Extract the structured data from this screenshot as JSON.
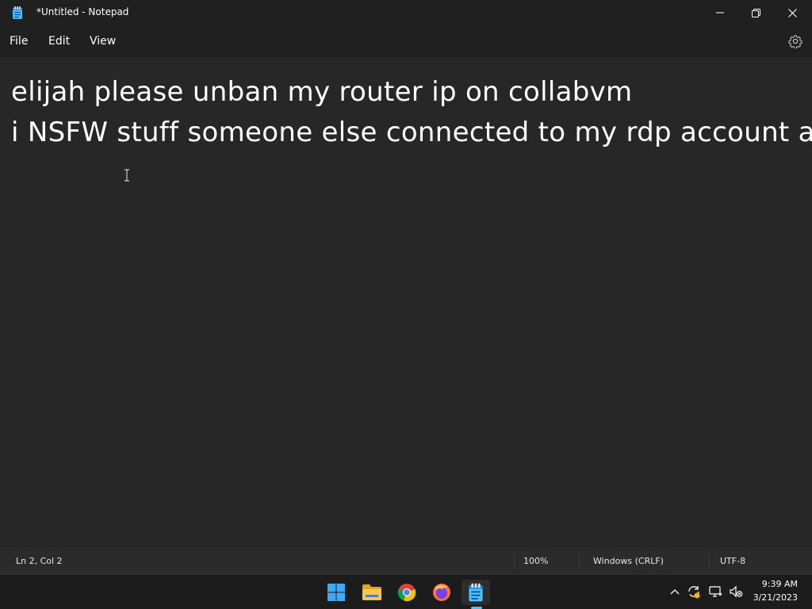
{
  "window": {
    "title": "*Untitled - Notepad",
    "icon": "notepad-icon"
  },
  "menu": {
    "file": "File",
    "edit": "Edit",
    "view": "View",
    "settings_icon": "gear-icon"
  },
  "editor": {
    "lines": [
      "elijah please unban my router ip on collabvm",
      "i NSFW stuff someone else connected to my rdp account ar"
    ]
  },
  "status": {
    "position": "Ln 2, Col 2",
    "zoom": "100%",
    "line_ending": "Windows (CRLF)",
    "encoding": "UTF-8"
  },
  "taskbar": {
    "apps": [
      "start-icon",
      "file-explorer-icon",
      "chrome-icon",
      "firefox-icon",
      "notepad-icon"
    ],
    "active_indicator_color": "#4cc2ff",
    "tray": [
      "chevron-up-icon",
      "sync-icon",
      "network-icon",
      "volume-muted-icon"
    ],
    "time": "9:39 AM",
    "date": "3/21/2023"
  },
  "colors": {
    "titlebar": "#202020",
    "editor_bg": "#272727",
    "statusbar": "#2b2b2b",
    "taskbar": "#1c1c1c"
  }
}
